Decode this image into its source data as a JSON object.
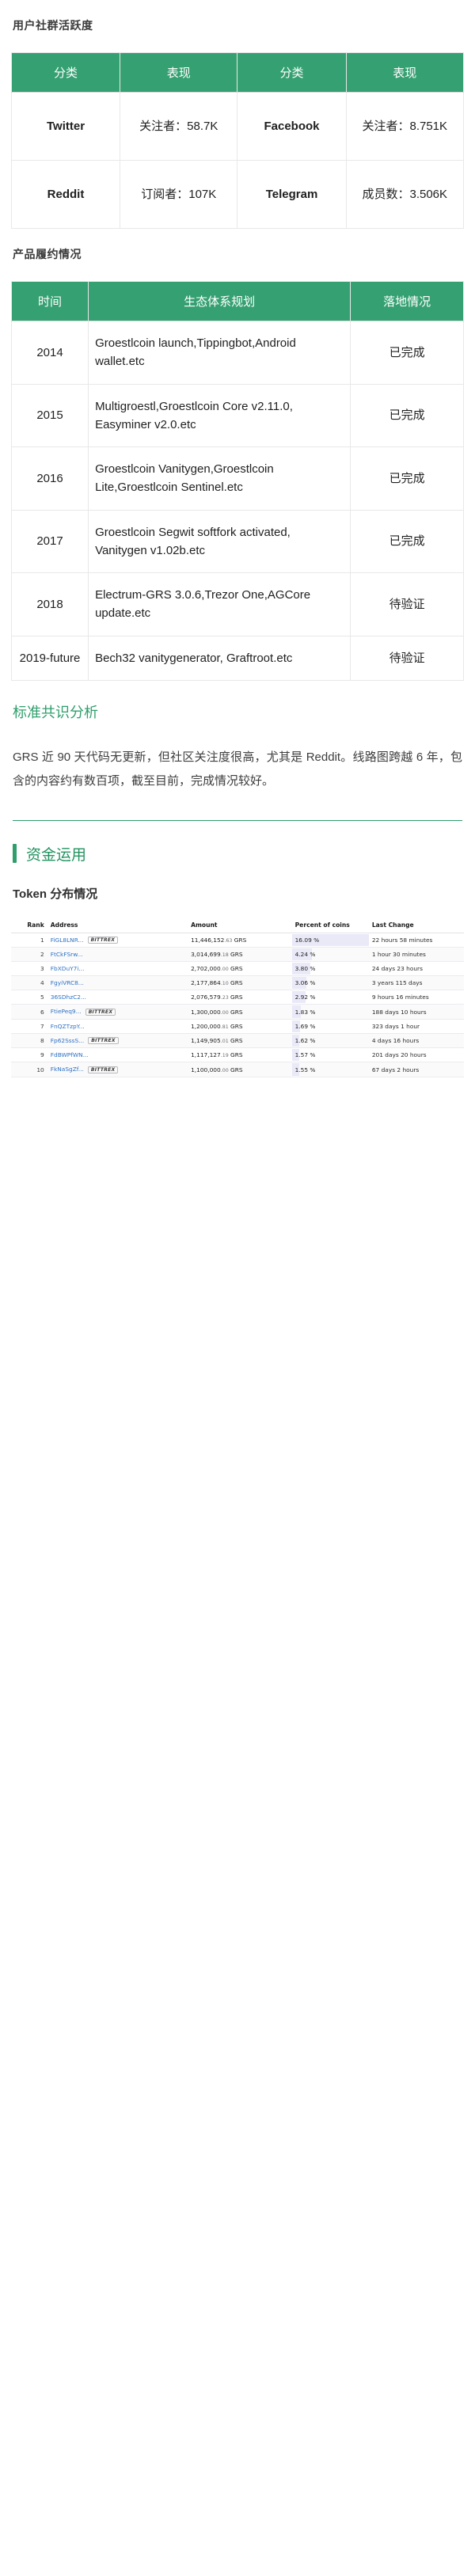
{
  "sections": {
    "social_heading": "用户社群活跃度",
    "roadmap_heading": "产品履约情况",
    "consensus_heading": "标准共识分析",
    "funds_heading": "资金运用",
    "token_subheading": "Token 分布情况"
  },
  "social_table": {
    "headers": [
      "分类",
      "表现",
      "分类",
      "表现"
    ],
    "rows": [
      [
        "Twitter",
        "关注者：58.7K",
        "Facebook",
        "关注者：8.751K"
      ],
      [
        "Reddit",
        "订阅者：107K",
        "Telegram",
        "成员数：3.506K"
      ]
    ]
  },
  "roadmap_table": {
    "headers": [
      "时间",
      "生态体系规划",
      "落地情况"
    ],
    "rows": [
      [
        "2014",
        "Groestlcoin launch,Tippingbot,Android wallet.etc",
        "已完成"
      ],
      [
        "2015",
        "Multigroestl,Groestlcoin Core v2.11.0, Easyminer v2.0.etc",
        "已完成"
      ],
      [
        "2016",
        "Groestlcoin Vanitygen,Groestlcoin Lite,Groestlcoin Sentinel.etc",
        "已完成"
      ],
      [
        "2017",
        "Groestlcoin Segwit softfork activated, Vanitygen v1.02b.etc",
        "已完成"
      ],
      [
        "2018",
        "Electrum-GRS 3.0.6,Trezor One,AGCore update.etc",
        "待验证"
      ],
      [
        "2019-future",
        "Bech32 vanitygenerator, Graftroot.etc",
        "待验证"
      ]
    ]
  },
  "consensus_paragraph": "GRS 近 90 天代码无更新，但社区关注度很高，尤其是 Reddit。线路图跨越 6 年，包含的内容约有数百项，截至目前，完成情况较好。",
  "rich_list": {
    "headers": [
      "Rank",
      "Address",
      "Amount",
      "Percent of coins",
      "Last Change"
    ],
    "unit": "GRS",
    "rows": [
      {
        "rank": "1",
        "address": "FiGL8LNR...",
        "tag": "BITTREX",
        "amount_int": "11,446,152",
        "amount_dec": ".63",
        "percent": "16.09 %",
        "percent_value": 16.09,
        "change": "22 hours 58 minutes"
      },
      {
        "rank": "2",
        "address": "FtCkFSrw...",
        "tag": "",
        "amount_int": "3,014,699",
        "amount_dec": ".18",
        "percent": "4.24 %",
        "percent_value": 4.24,
        "change": "1 hour 30 minutes"
      },
      {
        "rank": "3",
        "address": "FbXDuY7i...",
        "tag": "",
        "amount_int": "2,702,000",
        "amount_dec": ".00",
        "percent": "3.80 %",
        "percent_value": 3.8,
        "change": "24 days 23 hours"
      },
      {
        "rank": "4",
        "address": "FgyiVRC8...",
        "tag": "",
        "amount_int": "2,177,864",
        "amount_dec": ".10",
        "percent": "3.06 %",
        "percent_value": 3.06,
        "change": "3 years 115 days"
      },
      {
        "rank": "5",
        "address": "36SDhzC2...",
        "tag": "",
        "amount_int": "2,076,579",
        "amount_dec": ".23",
        "percent": "2.92 %",
        "percent_value": 2.92,
        "change": "9 hours 16 minutes"
      },
      {
        "rank": "6",
        "address": "FtiePeq9...",
        "tag": "BITTREX",
        "amount_int": "1,300,000",
        "amount_dec": ".00",
        "percent": "1.83 %",
        "percent_value": 1.83,
        "change": "188 days 10 hours"
      },
      {
        "rank": "7",
        "address": "FnQZTzpY...",
        "tag": "",
        "amount_int": "1,200,000",
        "amount_dec": ".81",
        "percent": "1.69 %",
        "percent_value": 1.69,
        "change": "323 days 1 hour"
      },
      {
        "rank": "8",
        "address": "Fp62SssS...",
        "tag": "BITTREX",
        "amount_int": "1,149,905",
        "amount_dec": ".01",
        "percent": "1.62 %",
        "percent_value": 1.62,
        "change": "4 days 16 hours"
      },
      {
        "rank": "9",
        "address": "FdBWPfWN...",
        "tag": "",
        "amount_int": "1,117,127",
        "amount_dec": ".19",
        "percent": "1.57 %",
        "percent_value": 1.57,
        "change": "201 days 20 hours"
      },
      {
        "rank": "10",
        "address": "FkNaSgZf...",
        "tag": "BITTREX",
        "amount_int": "1,100,000",
        "amount_dec": ".00",
        "percent": "1.55 %",
        "percent_value": 1.55,
        "change": "67 days 2 hours"
      }
    ]
  },
  "colors": {
    "accent_green": "#2e9e6b",
    "table_header_green": "#35a071",
    "link_blue": "#2f72c4",
    "pct_bar": "#e9e9f8"
  }
}
